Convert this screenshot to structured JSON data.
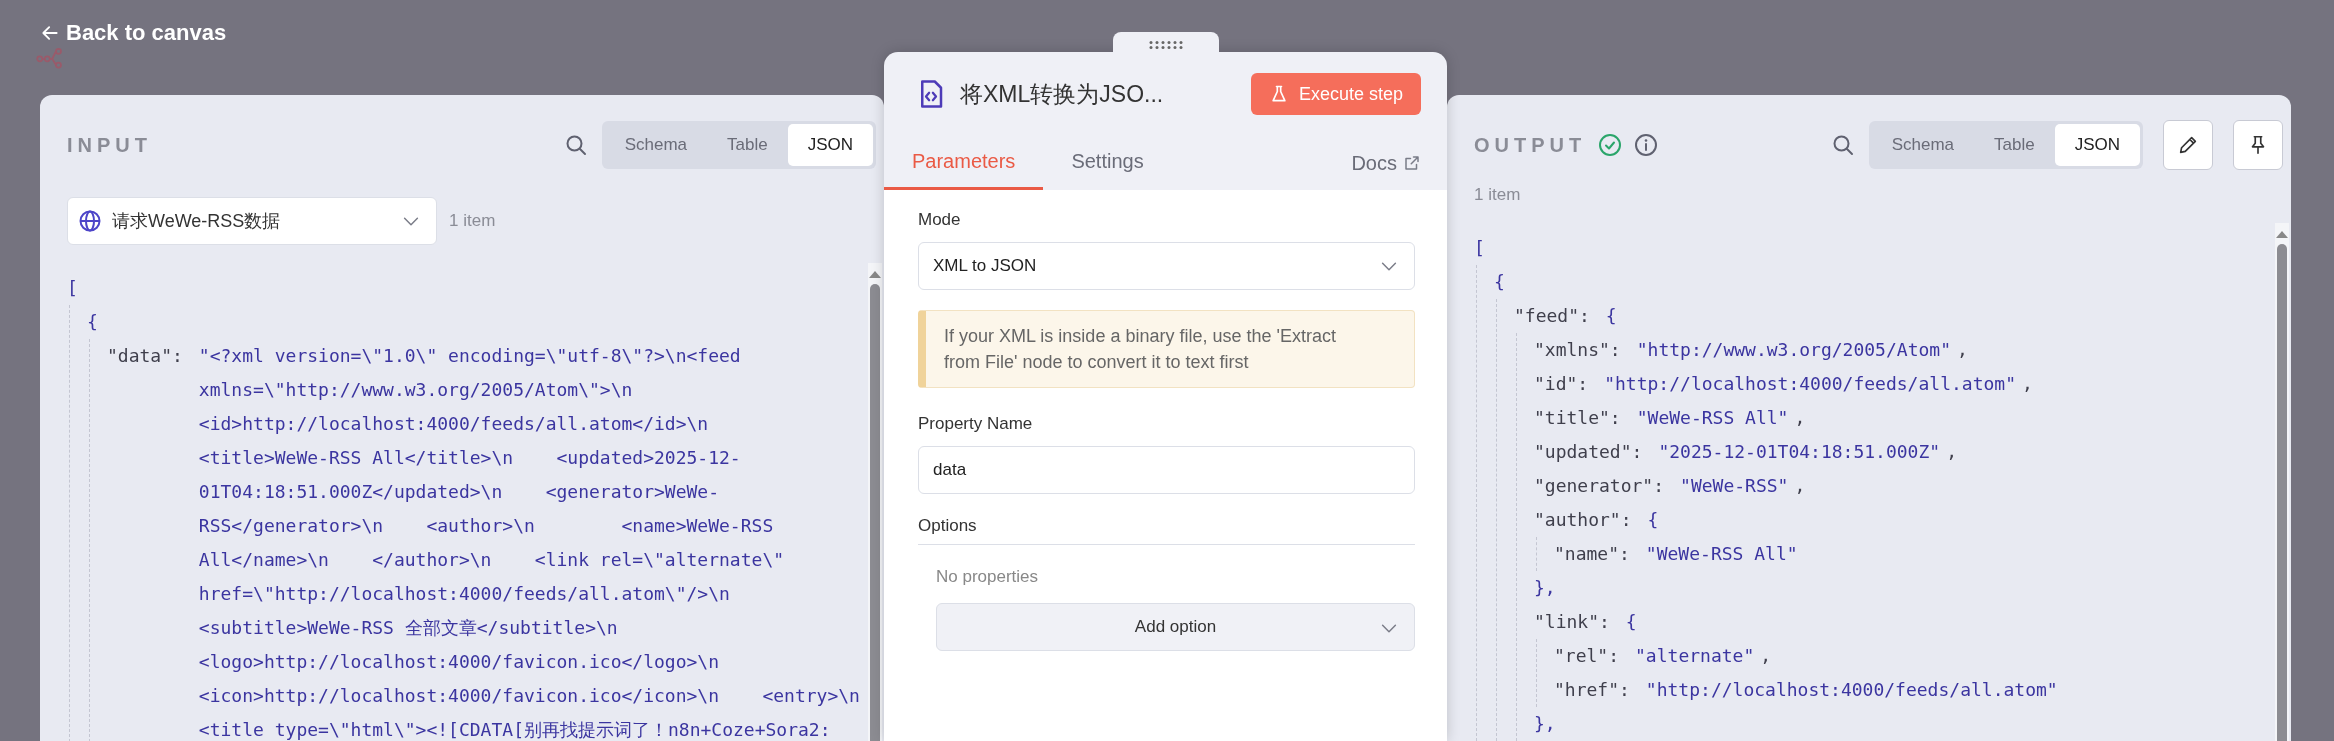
{
  "back_link": {
    "label": "Back to canvas"
  },
  "input": {
    "title": "INPUT",
    "views": [
      {
        "label": "Schema",
        "selected": false
      },
      {
        "label": "Table",
        "selected": false
      },
      {
        "label": "JSON",
        "selected": true
      }
    ],
    "source_node": "请求WeWe-RSS数据",
    "item_count": "1 item",
    "json": [
      {
        "value": "[",
        "children": [
          {
            "value": "{",
            "children": [
              {
                "key": "\"data\":",
                "value": "\"<?xml version=\\\"1.0\\\" encoding=\\\"utf-8\\\"?>\\n<feed xmlns=\\\"http://www.w3.org/2005/Atom\\\">\\n    <id>http://localhost:4000/feeds/all.atom</id>\\n    <title>WeWe-RSS All</title>\\n    <updated>2025-12-01T04:18:51.000Z</updated>\\n    <generator>WeWe-RSS</generator>\\n    <author>\\n        <name>WeWe-RSS All</name>\\n    </author>\\n    <link rel=\\\"alternate\\\" href=\\\"http://localhost:4000/feeds/all.atom\\\"/>\\n    <subtitle>WeWe-RSS 全部文章</subtitle>\\n    <logo>http://localhost:4000/favicon.ico</logo>\\n    <icon>http://localhost:4000/favicon.ico</icon>\\n    <entry>\\n        <title type=\\\"html\\\"><![CDATA[别再找提示词了！n8n+Coze+Sora2:"
              }
            ]
          }
        ]
      }
    ]
  },
  "node": {
    "title": "将XML转换为JSO...",
    "execute_button": "Execute step",
    "tabs": [
      {
        "label": "Parameters",
        "selected": true
      },
      {
        "label": "Settings",
        "selected": false
      }
    ],
    "docs_link": "Docs",
    "fields": [
      {
        "kind": "select",
        "label": "Mode",
        "value": "XML to JSON"
      },
      {
        "kind": "notice",
        "text": "If your XML is inside a binary file, use the 'Extract from File' node to convert it to text first"
      },
      {
        "kind": "text",
        "label": "Property Name",
        "value": "data"
      },
      {
        "kind": "options",
        "label": "Options",
        "empty_text": "No properties",
        "button": "Add option"
      }
    ]
  },
  "output": {
    "title": "OUTPUT",
    "succeeded": true,
    "views": [
      {
        "label": "Schema",
        "selected": false
      },
      {
        "label": "Table",
        "selected": false
      },
      {
        "label": "JSON",
        "selected": true
      }
    ],
    "item_count": "1 item",
    "json": [
      {
        "value": "[",
        "children": [
          {
            "value": "{",
            "children": [
              {
                "key": "\"feed\":",
                "value": "{",
                "children": [
                  {
                    "key": "\"xmlns\":",
                    "value": "\"http://www.w3.org/2005/Atom\"",
                    "tail": ","
                  },
                  {
                    "key": "\"id\":",
                    "value": "\"http://localhost:4000/feeds/all.atom\"",
                    "tail": ","
                  },
                  {
                    "key": "\"title\":",
                    "value": "\"WeWe-RSS All\"",
                    "tail": ","
                  },
                  {
                    "key": "\"updated\":",
                    "value": "\"2025-12-01T04:18:51.000Z\"",
                    "tail": ","
                  },
                  {
                    "key": "\"generator\":",
                    "value": "\"WeWe-RSS\"",
                    "tail": ","
                  },
                  {
                    "key": "\"author\":",
                    "value": "{",
                    "children": [
                      {
                        "key": "\"name\":",
                        "value": "\"WeWe-RSS All\""
                      }
                    ],
                    "close": "},"
                  },
                  {
                    "key": "\"link\":",
                    "value": "{",
                    "children": [
                      {
                        "key": "\"rel\":",
                        "value": "\"alternate\"",
                        "tail": ","
                      },
                      {
                        "key": "\"href\":",
                        "value": "\"http://localhost:4000/feeds/all.atom\""
                      }
                    ],
                    "close": "},"
                  }
                ]
              }
            ]
          }
        ]
      }
    ]
  }
}
